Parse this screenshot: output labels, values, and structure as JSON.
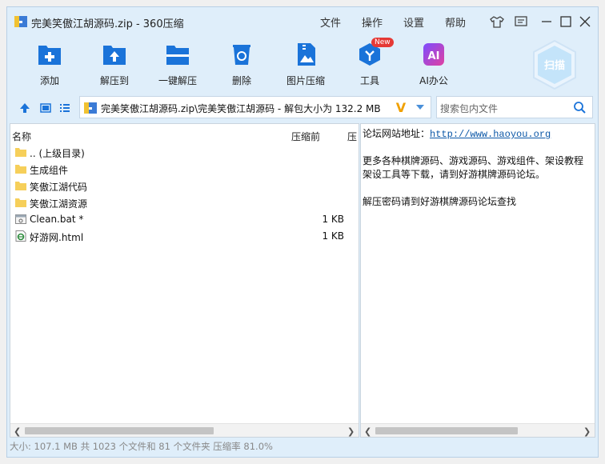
{
  "window": {
    "title": "完美笑傲江胡源码.zip - 360压缩"
  },
  "menu": {
    "file": "文件",
    "operate": "操作",
    "settings": "设置",
    "help": "帮助"
  },
  "toolbar": {
    "add": "添加",
    "extract_to": "解压到",
    "one_click": "一键解压",
    "delete": "删除",
    "image_compress": "图片压缩",
    "tools": "工具",
    "tools_badge": "New",
    "ai_office": "AI办公",
    "ai_icon_text": "AI",
    "scan": "扫描"
  },
  "address": {
    "path": "完美笑傲江胡源码.zip\\完美笑傲江胡源码 - 解包大小为 132.2 MB",
    "v_logo": "V"
  },
  "search": {
    "placeholder": "搜索包内文件"
  },
  "columns": {
    "name": "名称",
    "before": "压缩前",
    "after": "压"
  },
  "files": [
    {
      "name": ".. (上级目录)",
      "size": "",
      "type": "folder"
    },
    {
      "name": "生成组件",
      "size": "",
      "type": "folder"
    },
    {
      "name": "笑傲江湖代码",
      "size": "",
      "type": "folder"
    },
    {
      "name": "笑傲江湖资源",
      "size": "",
      "type": "folder"
    },
    {
      "name": "Clean.bat *",
      "size": "1 KB",
      "type": "bat"
    },
    {
      "name": "好游网.html",
      "size": "1 KB",
      "type": "html"
    }
  ],
  "preview": {
    "line1_label": "论坛网站地址：",
    "line1_link": "http://www.haoyou.org",
    "line2": "更多各种棋牌源码、游戏源码、游戏组件、架设教程",
    "line3": "架设工具等下载，请到好游棋牌源码论坛。",
    "line4": "解压密码请到好游棋牌源码论坛查找"
  },
  "status": {
    "text": "大小: 107.1 MB 共 1023 个文件和 81 个文件夹 压缩率 81.0%"
  },
  "colors": {
    "accent": "#1a73d9",
    "window_bg": "#dfeefa"
  }
}
